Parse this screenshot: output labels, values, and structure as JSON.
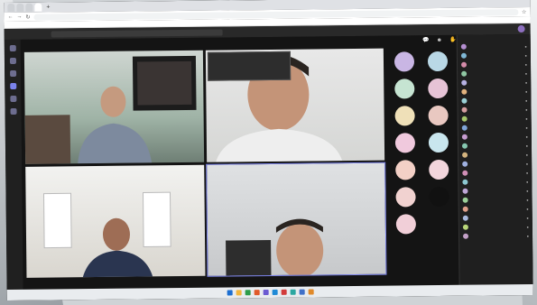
{
  "browser": {
    "tabs": [
      "",
      "",
      "",
      ""
    ],
    "url": "",
    "bookmarks": [
      "",
      "",
      "",
      "",
      "",
      "",
      ""
    ]
  },
  "teams": {
    "app_name": "",
    "search_placeholder": ""
  },
  "meeting": {
    "timer": "",
    "leave_label": "",
    "tiles": [
      {
        "label": ""
      },
      {
        "label": ""
      },
      {
        "label": ""
      },
      {
        "label": ""
      }
    ],
    "chat_popup": {
      "sender": "",
      "message": ""
    }
  },
  "avatars": [
    {
      "initials": "",
      "color": "#c9b6e4"
    },
    {
      "initials": "",
      "color": "#b9d8e6"
    },
    {
      "initials": "",
      "color": "#c6e4d2"
    },
    {
      "initials": "",
      "color": "#e6c3d6"
    },
    {
      "initials": "",
      "color": "#efe0b8"
    },
    {
      "initials": "",
      "color": "#e9c8c1"
    },
    {
      "initials": "",
      "color": "#f0c9dd"
    },
    {
      "initials": "",
      "color": "#c9e6ee"
    },
    {
      "initials": "",
      "color": "#f3d0c6"
    },
    {
      "initials": "",
      "color": "#f2d5dc"
    },
    {
      "initials": "",
      "color": "#f1d2d0"
    },
    {
      "initials": "",
      "color": "#111111"
    },
    {
      "initials": "",
      "color": "#f1cfd8"
    }
  ],
  "participants": {
    "title": "",
    "list": [
      {
        "name": "",
        "color": "#b58fd1"
      },
      {
        "name": "",
        "color": "#7fb8d6"
      },
      {
        "name": "",
        "color": "#d48ba9"
      },
      {
        "name": "",
        "color": "#8fc7a3"
      },
      {
        "name": "",
        "color": "#b6b1e2"
      },
      {
        "name": "",
        "color": "#e1b27e"
      },
      {
        "name": "",
        "color": "#9bd1d6"
      },
      {
        "name": "",
        "color": "#d59ea0"
      },
      {
        "name": "",
        "color": "#a5c66b"
      },
      {
        "name": "",
        "color": "#7fa4d8"
      },
      {
        "name": "",
        "color": "#c79dd1"
      },
      {
        "name": "",
        "color": "#86c7b0"
      },
      {
        "name": "",
        "color": "#d4b47f"
      },
      {
        "name": "",
        "color": "#9fb0df"
      },
      {
        "name": "",
        "color": "#d08fb6"
      },
      {
        "name": "",
        "color": "#8cc7d1"
      },
      {
        "name": "",
        "color": "#bfa7d8"
      },
      {
        "name": "",
        "color": "#9dd19a"
      },
      {
        "name": "",
        "color": "#e0a08b"
      },
      {
        "name": "",
        "color": "#a9b9de"
      },
      {
        "name": "",
        "color": "#b9d67a"
      },
      {
        "name": "",
        "color": "#c3a0c7"
      }
    ]
  },
  "taskbar": {
    "icon_colors": [
      "#1d6fd1",
      "#f2b63c",
      "#2d9c4a",
      "#e05a2b",
      "#6b5bd2",
      "#1f8ad6",
      "#d23b3b",
      "#2ba7a1",
      "#4070c8",
      "#e08a2b"
    ],
    "clock": ""
  }
}
